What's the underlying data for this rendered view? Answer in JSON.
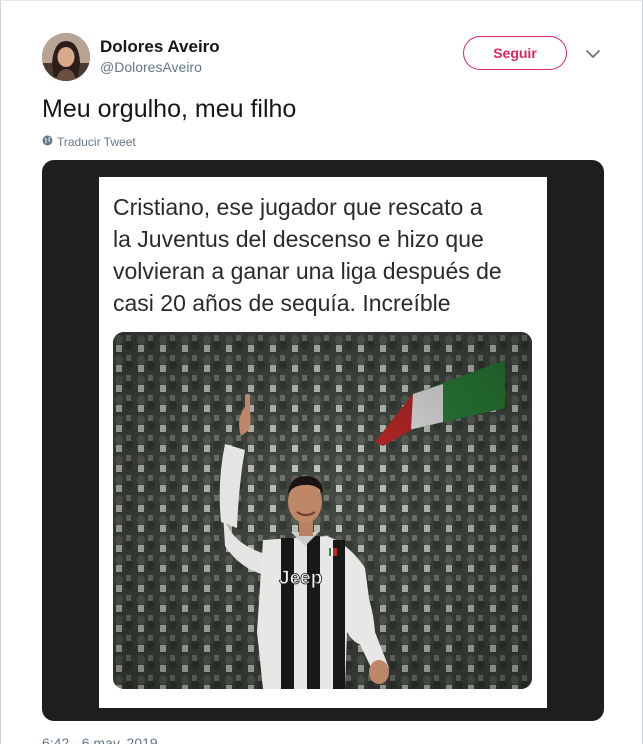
{
  "author": {
    "name": "Dolores Aveiro",
    "handle": "@DoloresAveiro"
  },
  "actions": {
    "follow_label": "Seguir",
    "menu_icon": "chevron-down-icon"
  },
  "tweet": {
    "text": "Meu orgulho, meu filho",
    "translate_label": "Traducir Tweet",
    "timestamp": "6:42 - 6 may. 2019"
  },
  "media": {
    "caption_lines": [
      "Cristiano, ese jugador que rescato a",
      "la Juventus del descenso e hizo que",
      "volvieran a ganar una liga después de",
      "casi 20 años de sequía. Increíble"
    ],
    "jersey_text": "Jeep"
  },
  "colors": {
    "follow_accent": "#e0245e",
    "secondary_text": "#657786",
    "media_background": "#1e1e1e"
  }
}
